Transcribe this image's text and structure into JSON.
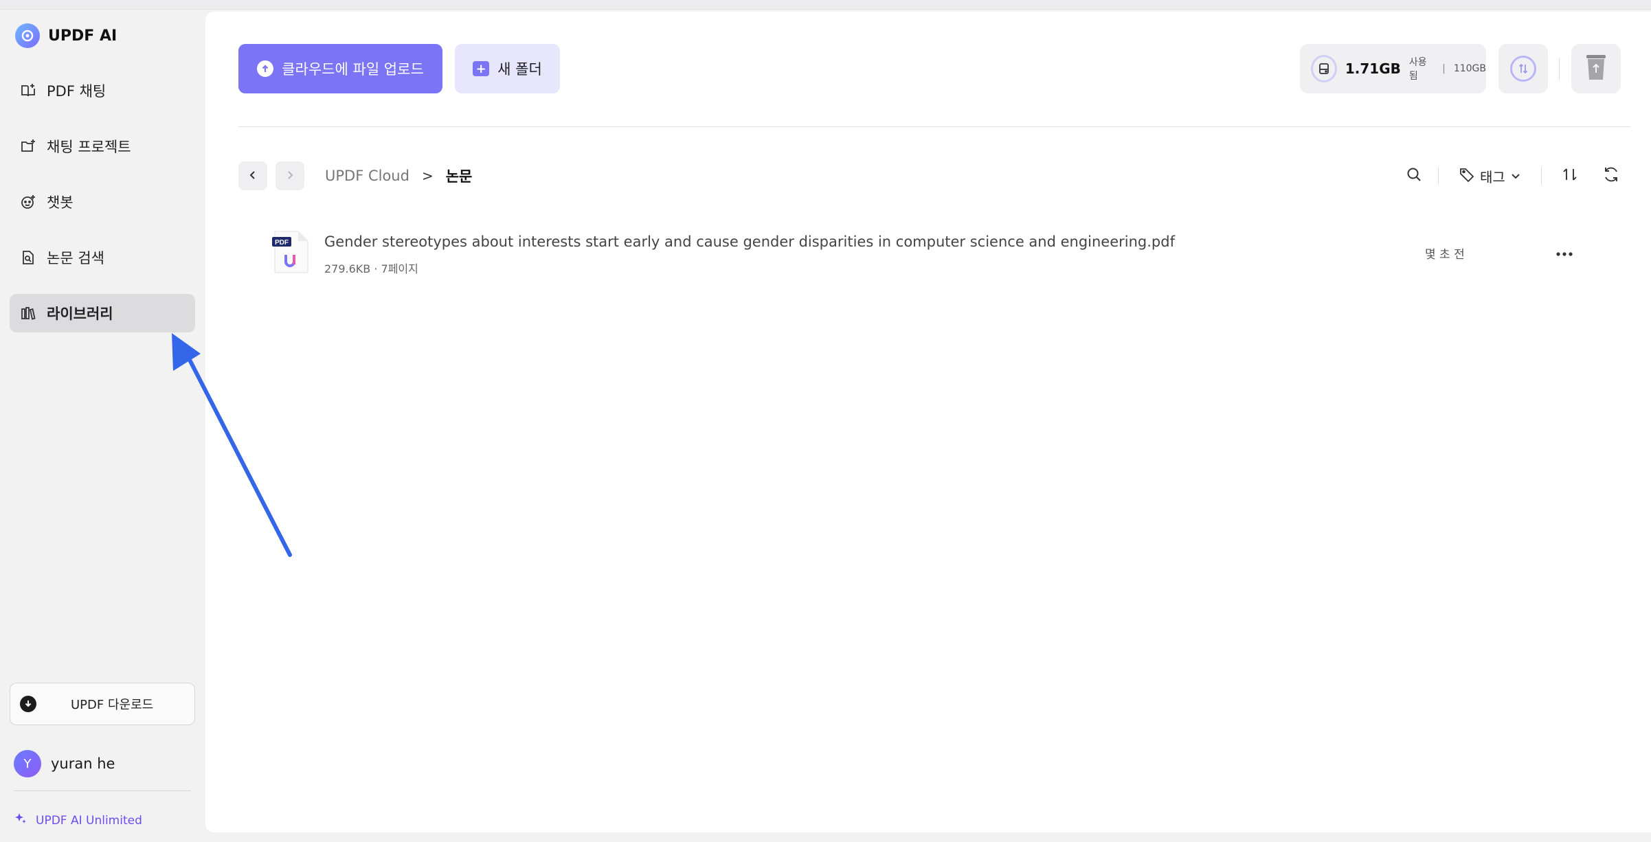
{
  "app": {
    "name": "UPDF AI"
  },
  "sidebar": {
    "items": [
      {
        "label": "PDF 채팅",
        "icon": "book-chat-icon"
      },
      {
        "label": "채팅 프로젝트",
        "icon": "folder-add-icon"
      },
      {
        "label": "챗봇",
        "icon": "bot-icon"
      },
      {
        "label": "논문 검색",
        "icon": "doc-search-icon"
      },
      {
        "label": "라이브러리",
        "icon": "library-icon",
        "active": true
      }
    ],
    "download_label": "UPDF 다운로드",
    "user": {
      "initial": "Y",
      "name": "yuran he"
    },
    "plan_label": "UPDF AI Unlimited"
  },
  "toolbar": {
    "upload_label": "클라우드에 파일 업로드",
    "new_folder_label": "새 폴더",
    "storage": {
      "used": "1.71GB",
      "used_label": "사용됨",
      "separator": "|",
      "total": "110GB"
    }
  },
  "breadcrumb": {
    "root": "UPDF Cloud",
    "separator": ">",
    "current": "논문"
  },
  "tools": {
    "tag_label": "태그"
  },
  "files": [
    {
      "name": "Gender stereotypes about interests start early and cause gender disparities in computer science and engineering.pdf",
      "meta": "279.6KB · 7페이지",
      "time": "몇 초 전",
      "icon_badge": "PDF"
    }
  ],
  "colors": {
    "accent": "#7b74f5",
    "accent_light": "#e7e6fd",
    "annotation_arrow": "#3366e8",
    "plan": "#6a4cf0"
  }
}
